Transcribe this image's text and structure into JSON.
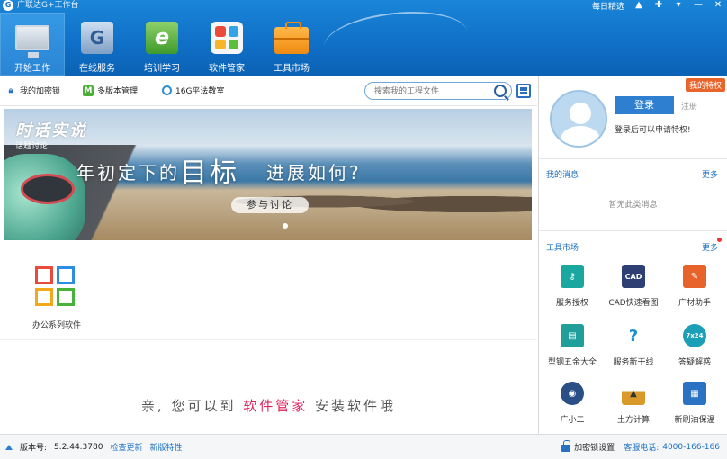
{
  "window": {
    "title": "广联达G+工作台",
    "daily_pick": "每日精选"
  },
  "nav": {
    "items": [
      {
        "label": "开始工作",
        "icon": "monitor-icon"
      },
      {
        "label": "在线服务",
        "icon": "online-service-icon"
      },
      {
        "label": "培训学习",
        "icon": "training-icon"
      },
      {
        "label": "软件管家",
        "icon": "software-manager-icon"
      },
      {
        "label": "工具市场",
        "icon": "toolbox-icon"
      }
    ]
  },
  "toolbar": {
    "lock_label": "我的加密锁",
    "multi_version_label": "多版本管理",
    "cd_label": "16G平法教室",
    "search_placeholder": "搜索我的工程文件"
  },
  "banner": {
    "brand": "时话实说",
    "sub": "话题讨论",
    "headline_a": "年初定下的",
    "headline_big": "目标",
    "headline_b": "进展如何?",
    "join_label": "参与讨论"
  },
  "apps": {
    "office_label": "办公系列软件"
  },
  "hint": {
    "prefix": "亲, 您可以到",
    "highlight": "软件管家",
    "suffix": "安装软件哦"
  },
  "user_panel": {
    "vip_label": "我的特权",
    "login_label": "登录",
    "register_label": "注册",
    "login_tip": "登录后可以申请特权!"
  },
  "messages": {
    "title": "我的消息",
    "more": "更多",
    "empty": "暂无此类消息"
  },
  "tool_market": {
    "title": "工具市场",
    "more": "更多",
    "tools": [
      {
        "name": "服务授权",
        "icon": "service-auth-icon",
        "glyph": "",
        "color": "#1aa7a0"
      },
      {
        "name": "CAD快速看图",
        "icon": "cad-viewer-icon",
        "glyph": "CAD",
        "color": "#2d3f73"
      },
      {
        "name": "广材助手",
        "icon": "material-assistant-icon",
        "glyph": "",
        "color": "#e8622b"
      },
      {
        "name": "型钢五金大全",
        "icon": "steel-hardware-icon",
        "glyph": "",
        "color": "#1f9e9a"
      },
      {
        "name": "服务新干线",
        "icon": "service-express-icon",
        "glyph": "?",
        "color": "#1b8fd6"
      },
      {
        "name": "答疑解惑",
        "icon": "qa-icon",
        "glyph": "7x24",
        "color": "#1a9fb6"
      },
      {
        "name": "广小二",
        "icon": "robot-assistant-icon",
        "glyph": "",
        "color": "#2a4f86"
      },
      {
        "name": "土方计算",
        "icon": "earthwork-calc-icon",
        "glyph": "",
        "color": "#d99a2b"
      },
      {
        "name": "新刷油保温",
        "icon": "paint-insulation-icon",
        "glyph": "",
        "color": "#2b73c2"
      }
    ]
  },
  "status": {
    "version_label": "版本号:",
    "version": "5.2.44.3780",
    "check_update": "检查更新",
    "new_features": "新版特性",
    "lock_settings": "加密锁设置",
    "hotline_label": "客服电话:",
    "hotline": "4000-166-166"
  },
  "colors": {
    "brand_blue": "#0f6fc6",
    "link_blue": "#1a6fc0",
    "highlight_pink": "#e0245e",
    "vip_orange": "#e8642b"
  }
}
